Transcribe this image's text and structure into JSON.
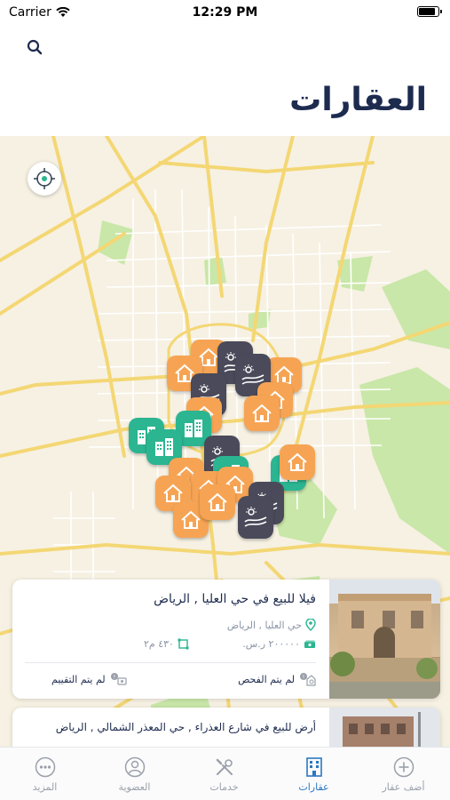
{
  "status_bar": {
    "carrier": "Carrier",
    "time": "12:29 PM",
    "battery_level": 0.9
  },
  "header": {
    "title": "العقارات",
    "search_icon": "search-icon"
  },
  "map": {
    "locate_icon": "crosshair-icon",
    "pins": [
      {
        "kind": "house",
        "color": "orange"
      },
      {
        "kind": "building",
        "color": "teal"
      },
      {
        "kind": "land",
        "color": "dark"
      }
    ]
  },
  "listings": [
    {
      "title": "فيلا للبيع في حي العليا , الرياض",
      "location": "حي العليا , الرياض",
      "price": "٢٠٠٠٠٠ ر.س.",
      "area": "٤٣٠ م٢",
      "inspection": "لم يتم الفحص",
      "valuation": "لم يتم التقييم"
    },
    {
      "title": "أرض للبيع في شارع العذراء , حي المعذر الشمالي , الرياض"
    }
  ],
  "tabs": [
    {
      "label": "المزيد",
      "icon": "more-icon"
    },
    {
      "label": "العضوية",
      "icon": "membership-icon"
    },
    {
      "label": "خدمات",
      "icon": "services-icon"
    },
    {
      "label": "عقارات",
      "icon": "properties-icon",
      "active": true
    },
    {
      "label": "أضف عقار",
      "icon": "add-property-icon"
    }
  ],
  "colors": {
    "primary": "#1d2b4f",
    "accent": "#2b78c2",
    "pin_orange": "#f6a454",
    "pin_teal": "#2bb591",
    "pin_dark": "#4a4a5a",
    "map_bg": "#f6f1e3",
    "map_road": "#f4d774",
    "map_park": "#c9e7a8"
  }
}
